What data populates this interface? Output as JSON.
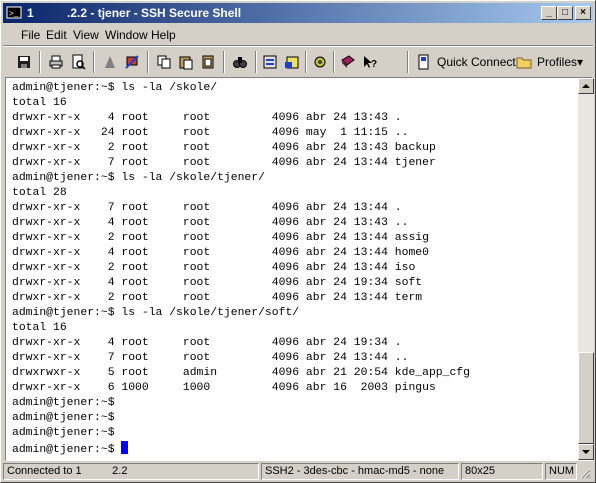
{
  "window": {
    "title": "1          .2.2 - tjener - SSH Secure Shell",
    "minimize_glyph": "_",
    "maximize_glyph": "□",
    "close_glyph": "×"
  },
  "menu": [
    "File",
    "Edit",
    "View",
    "Window",
    "Help"
  ],
  "toolbar": {
    "quick_connect_label": "Quick Connect",
    "profiles_label": "Profiles",
    "profiles_arrow": "▾"
  },
  "terminal": {
    "lines": [
      "admin@tjener:~$ ls -la /skole/",
      "total 16",
      "drwxr-xr-x    4 root     root         4096 abr 24 13:43 .",
      "drwxr-xr-x   24 root     root         4096 may  1 11:15 ..",
      "drwxr-xr-x    2 root     root         4096 abr 24 13:43 backup",
      "drwxr-xr-x    7 root     root         4096 abr 24 13:44 tjener",
      "admin@tjener:~$ ls -la /skole/tjener/",
      "total 28",
      "drwxr-xr-x    7 root     root         4096 abr 24 13:44 .",
      "drwxr-xr-x    4 root     root         4096 abr 24 13:43 ..",
      "drwxr-xr-x    2 root     root         4096 abr 24 13:44 assig",
      "drwxr-xr-x    4 root     root         4096 abr 24 13:44 home0",
      "drwxr-xr-x    2 root     root         4096 abr 24 13:44 iso",
      "drwxr-xr-x    4 root     root         4096 abr 24 19:34 soft",
      "drwxr-xr-x    2 root     root         4096 abr 24 13:44 term",
      "admin@tjener:~$ ls -la /skole/tjener/soft/",
      "total 16",
      "drwxr-xr-x    4 root     root         4096 abr 24 19:34 .",
      "drwxr-xr-x    7 root     root         4096 abr 24 13:44 ..",
      "drwxrwxr-x    5 root     admin        4096 abr 21 20:54 kde_app_cfg",
      "drwxr-xr-x    6 1000     1000         4096 abr 16  2003 pingus",
      "admin@tjener:~$",
      "admin@tjener:~$",
      "admin@tjener:~$",
      "admin@tjener:~$ "
    ],
    "scroll_position": 1.0
  },
  "status": {
    "connection": "Connected to 1          2.2",
    "cipher": "SSH2 - 3des-cbc - hmac-md5 - none",
    "size": "80x25",
    "num": "NUM"
  }
}
